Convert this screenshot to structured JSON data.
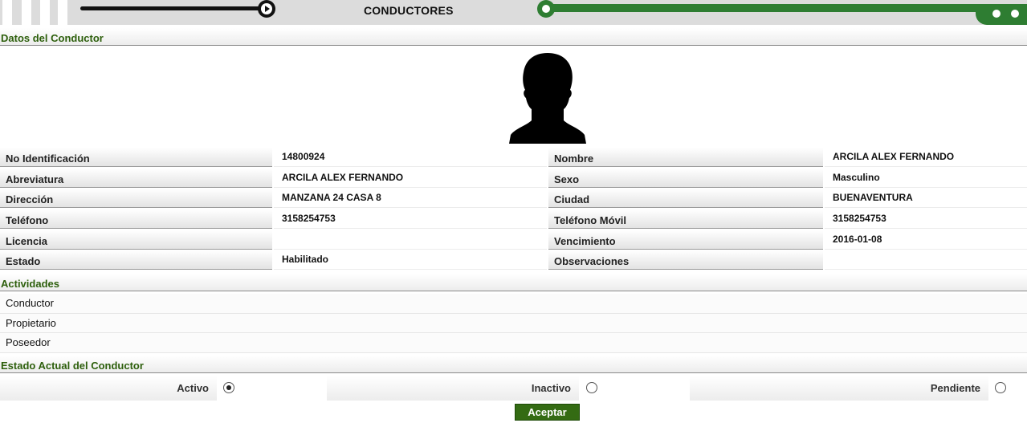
{
  "header": {
    "title": "CONDUCTORES",
    "accent_color": "#2e7d32"
  },
  "sections": {
    "datos": "Datos del Conductor",
    "actividades": "Actividades",
    "estado_actual": "Estado Actual del Conductor"
  },
  "driver_fields": [
    {
      "left_label": "No Identificación",
      "left_value": "14800924",
      "right_label": "Nombre",
      "right_value": "ARCILA ALEX FERNANDO"
    },
    {
      "left_label": "Abreviatura",
      "left_value": "ARCILA ALEX FERNANDO",
      "right_label": "Sexo",
      "right_value": "Masculino"
    },
    {
      "left_label": "Dirección",
      "left_value": "MANZANA 24 CASA 8",
      "right_label": "Ciudad",
      "right_value": "BUENAVENTURA"
    },
    {
      "left_label": "Teléfono",
      "left_value": "3158254753",
      "right_label": "Teléfono Móvil",
      "right_value": "3158254753"
    },
    {
      "left_label": "Licencia",
      "left_value": "",
      "right_label": "Vencimiento",
      "right_value": "2016-01-08"
    },
    {
      "left_label": "Estado",
      "left_value": "Habilitado",
      "right_label": "Observaciones",
      "right_value": ""
    }
  ],
  "activities": [
    "Conductor",
    "Propietario",
    "Poseedor"
  ],
  "status_options": [
    {
      "label": "Activo",
      "checked": true
    },
    {
      "label": "Inactivo",
      "checked": false
    },
    {
      "label": "Pendiente",
      "checked": false
    }
  ],
  "accept_label": "Aceptar",
  "avatar_icon": "person-silhouette-icon"
}
